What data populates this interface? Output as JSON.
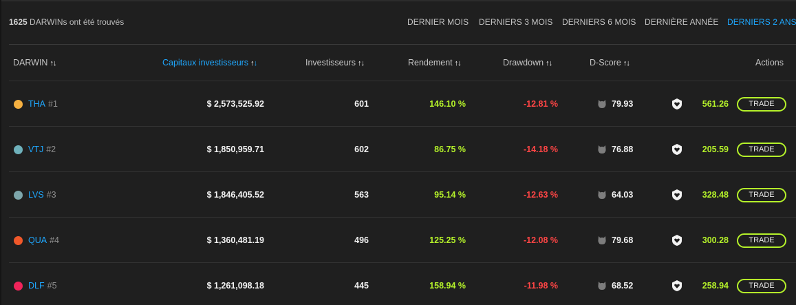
{
  "summary": {
    "count": "1625",
    "suffix": " DARWINs ont été trouvés"
  },
  "periods": [
    {
      "label": "DERNIER MOIS",
      "active": false
    },
    {
      "label": "DERNIERS 3 MOIS",
      "active": false
    },
    {
      "label": "DERNIERS 6 MOIS",
      "active": false
    },
    {
      "label": "DERNIÈRE ANNÉE",
      "active": false
    },
    {
      "label": "DERNIERS 2 ANS",
      "active": true
    }
  ],
  "columns": {
    "darwin": "DARWIN",
    "capital": "Capitaux investisseurs",
    "investors": "Investisseurs",
    "return": "Rendement",
    "drawdown": "Drawdown",
    "dscore": "D-Score",
    "actions": "Actions"
  },
  "rows": [
    {
      "color": "#f5b041",
      "ticker": "THA",
      "rank": "#1",
      "capital": "$ 2,573,525.92",
      "investors": "601",
      "return": "146.10 %",
      "drawdown": "-12.81 %",
      "dscore": "79.93",
      "price": "561.26",
      "trade": "TRADE"
    },
    {
      "color": "#6fb1bb",
      "ticker": "VTJ",
      "rank": "#2",
      "capital": "$ 1,850,959.71",
      "investors": "602",
      "return": "86.75 %",
      "drawdown": "-14.18 %",
      "dscore": "76.88",
      "price": "205.59",
      "trade": "TRADE"
    },
    {
      "color": "#7da6ab",
      "ticker": "LVS",
      "rank": "#3",
      "capital": "$ 1,846,405.52",
      "investors": "563",
      "return": "95.14 %",
      "drawdown": "-12.63 %",
      "dscore": "64.03",
      "price": "328.48",
      "trade": "TRADE"
    },
    {
      "color": "#f0582a",
      "ticker": "QUA",
      "rank": "#4",
      "capital": "$ 1,360,481.19",
      "investors": "496",
      "return": "125.25 %",
      "drawdown": "-12.08 %",
      "dscore": "79.68",
      "price": "300.28",
      "trade": "TRADE"
    },
    {
      "color": "#f0245a",
      "ticker": "DLF",
      "rank": "#5",
      "capital": "$ 1,261,098.18",
      "investors": "445",
      "return": "158.94 %",
      "drawdown": "-11.98 %",
      "dscore": "68.52",
      "price": "258.94",
      "trade": "TRADE"
    }
  ]
}
